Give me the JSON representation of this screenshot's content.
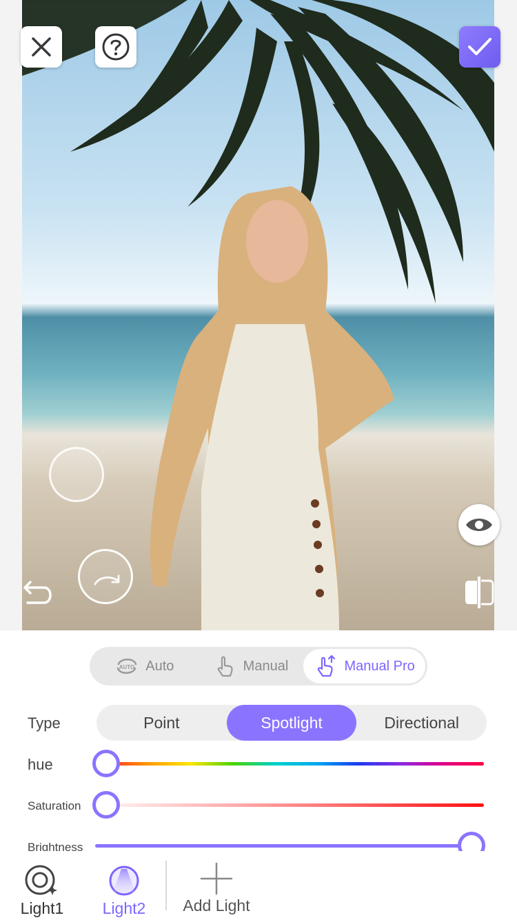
{
  "toolbar": {
    "close_icon": "close-icon",
    "help_icon": "help-icon",
    "confirm_icon": "check-icon"
  },
  "canvas": {
    "undo_icon": "undo-icon",
    "redo_icon": "redo-icon",
    "preview_icon": "eye-icon",
    "compare_icon": "compare-icon"
  },
  "modes": [
    {
      "label": "Auto",
      "icon": "auto-icon",
      "active": false
    },
    {
      "label": "Manual",
      "icon": "tap-icon",
      "active": false
    },
    {
      "label": "Manual Pro",
      "icon": "tap-pro-icon",
      "active": true
    }
  ],
  "type": {
    "label": "Type",
    "options": [
      "Point",
      "Spotlight",
      "Directional"
    ],
    "selected": "Spotlight"
  },
  "sliders": {
    "hue": {
      "label": "hue",
      "value": 0.0
    },
    "saturation": {
      "label": "Saturation",
      "value": 0.0
    },
    "brightness": {
      "label": "Brightness",
      "value": 1.0
    }
  },
  "lights": {
    "items": [
      {
        "label": "Light1",
        "active": false
      },
      {
        "label": "Light2",
        "active": true
      }
    ],
    "add_label": "Add Light"
  },
  "colors": {
    "accent": "#8a74ff",
    "accent_text": "#7b66ff"
  }
}
